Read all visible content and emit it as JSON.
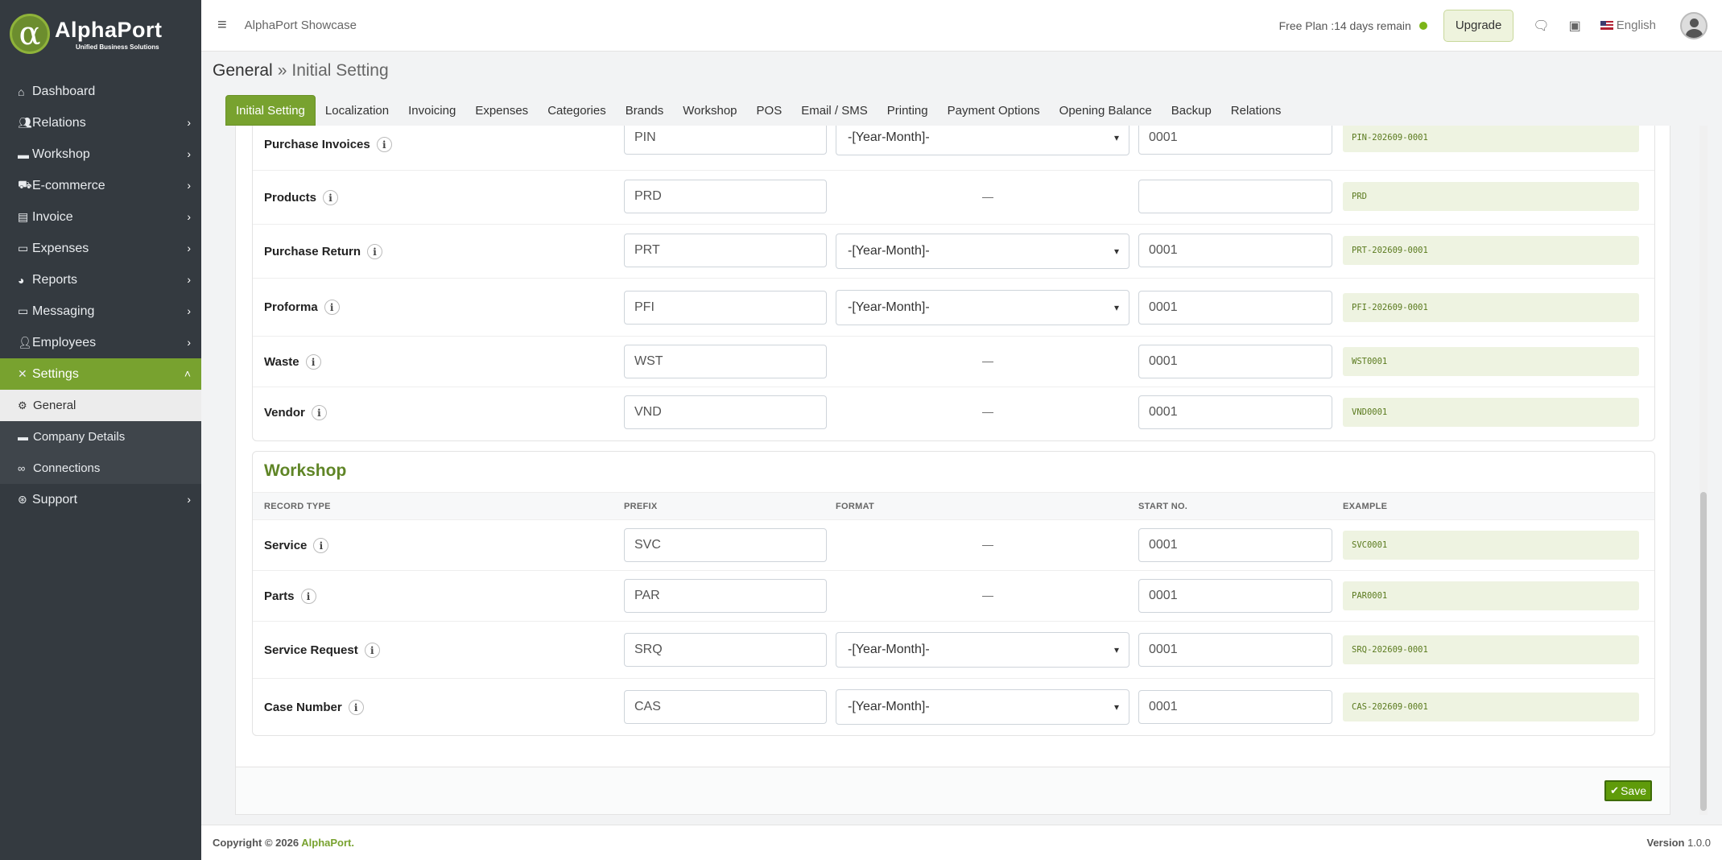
{
  "brand": {
    "logo_symbol": "α",
    "name": "AlphaPort",
    "tagline": "Unified Business Solutions"
  },
  "sidebar": {
    "items": [
      {
        "icon": "home-icon",
        "label": "Dashboard",
        "has_children": false
      },
      {
        "icon": "users-icon",
        "label": "Relations",
        "has_children": true
      },
      {
        "icon": "toolbox-icon",
        "label": "Workshop",
        "has_children": true
      },
      {
        "icon": "cart-icon",
        "label": "E-commerce",
        "has_children": true
      },
      {
        "icon": "document-icon",
        "label": "Invoice",
        "has_children": true
      },
      {
        "icon": "money-icon",
        "label": "Expenses",
        "has_children": true
      },
      {
        "icon": "pie-chart-icon",
        "label": "Reports",
        "has_children": true
      },
      {
        "icon": "message-icon",
        "label": "Messaging",
        "has_children": true
      },
      {
        "icon": "employees-icon",
        "label": "Employees",
        "has_children": true
      },
      {
        "icon": "tools-icon",
        "label": "Settings",
        "has_children": true,
        "expanded": true
      }
    ],
    "settings_children": [
      {
        "icon": "gear-icon",
        "label": "General",
        "current": true
      },
      {
        "icon": "briefcase-icon",
        "label": "Company Details"
      },
      {
        "icon": "link-icon",
        "label": "Connections"
      }
    ],
    "support": {
      "icon": "lifebuoy-icon",
      "label": "Support"
    }
  },
  "topbar": {
    "app_name": "AlphaPort Showcase",
    "plan_text": "Free Plan :14 days remain",
    "upgrade_label": "Upgrade",
    "language": "English"
  },
  "breadcrumb": {
    "parent": "General",
    "separator": "»",
    "current": "Initial Setting"
  },
  "tabs": [
    "Initial Setting",
    "Localization",
    "Invoicing",
    "Expenses",
    "Categories",
    "Brands",
    "Workshop",
    "POS",
    "Email / SMS",
    "Printing",
    "Payment Options",
    "Opening Balance",
    "Backup",
    "Relations"
  ],
  "active_tab": "Initial Setting",
  "general_rows": [
    {
      "name": "Purchase Invoices",
      "prefix": "PIN",
      "format": "-[Year-Month]-",
      "start": "0001",
      "start_placeholder": "",
      "example": "PIN-202609-0001"
    },
    {
      "name": "Products",
      "prefix": "PRD",
      "format": null,
      "start": "",
      "start_placeholder": "",
      "example": "PRD"
    },
    {
      "name": "Purchase Return",
      "prefix": "PRT",
      "format": "-[Year-Month]-",
      "start": "0001",
      "start_placeholder": "",
      "example": "PRT-202609-0001"
    },
    {
      "name": "Proforma",
      "prefix": "PFI",
      "format": "-[Year-Month]-",
      "start": "0001",
      "start_placeholder": "",
      "example": "PFI-202609-0001"
    },
    {
      "name": "Waste",
      "prefix": "WST",
      "format": null,
      "start": "0001",
      "start_placeholder": "",
      "example": "WST0001"
    },
    {
      "name": "Vendor",
      "prefix": "VND",
      "format": null,
      "start": "0001",
      "start_placeholder": "",
      "example": "VND0001"
    }
  ],
  "workshop": {
    "title": "Workshop",
    "columns": [
      "RECORD TYPE",
      "PREFIX",
      "FORMAT",
      "START NO.",
      "EXAMPLE"
    ],
    "rows": [
      {
        "name": "Service",
        "prefix": "SVC",
        "format": null,
        "start": "0001",
        "example": "SVC0001"
      },
      {
        "name": "Parts",
        "prefix": "PAR",
        "format": null,
        "start": "0001",
        "example": "PAR0001"
      },
      {
        "name": "Service Request",
        "prefix": "SRQ",
        "format": "-[Year-Month]-",
        "start": "0001",
        "example": "SRQ-202609-0001"
      },
      {
        "name": "Case Number",
        "prefix": "CAS",
        "format": "-[Year-Month]-",
        "start": "0001",
        "example": "CAS-202609-0001"
      }
    ]
  },
  "no_format_text": "—",
  "save_label": "Save",
  "footer": {
    "copyright": "Copyright © 2026",
    "brand": "AlphaPort.",
    "version_label": "Version",
    "version": "1.0.0"
  },
  "colors": {
    "accent": "#78a22f",
    "sidebar": "#343a40",
    "example_bg": "#eef3e1"
  }
}
